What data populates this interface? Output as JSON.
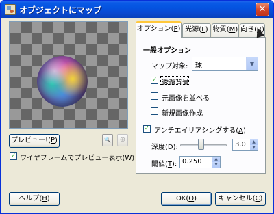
{
  "window": {
    "title": "オブジェクトにマップ",
    "close_glyph": "✕"
  },
  "preview": {
    "button_label": "プレビュー!",
    "button_mnemonic": "P",
    "wireframe_label": "ワイヤフレームでプレビュー表示",
    "wireframe_mnemonic": "W",
    "wireframe_checked": true,
    "zoom_out_glyph": "🔍",
    "zoom_in_glyph": "⊕"
  },
  "tabs": [
    {
      "label": "オプション",
      "mnemonic": "P",
      "active": true
    },
    {
      "label": "光源",
      "mnemonic": "L",
      "active": false
    },
    {
      "label": "物質",
      "mnemonic": "M",
      "active": false
    },
    {
      "label": "向き",
      "mnemonic": "R",
      "active": false
    }
  ],
  "options": {
    "section_title": "一般オプション",
    "map_target_label": "マップ対象:",
    "map_target_value": "球",
    "transparent_bg_label": "透過背景",
    "transparent_bg_checked": true,
    "tile_source_label": "元画像を並べる",
    "tile_source_checked": false,
    "new_image_label": "新規画像作成",
    "new_image_checked": false,
    "antialias_label": "アンチエイリアシングする",
    "antialias_mnemonic": "A",
    "antialias_checked": true,
    "depth_label": "深度",
    "depth_mnemonic": "D",
    "depth_value": "3.0",
    "depth_slider_fraction": 0.44,
    "threshold_label": "閾値",
    "threshold_mnemonic": "T",
    "threshold_value": "0.250"
  },
  "buttons": {
    "help_label": "ヘルプ",
    "help_mnemonic": "H",
    "ok_label": "OK",
    "ok_mnemonic": "O",
    "cancel_label": "キャンセル",
    "cancel_mnemonic": "C"
  }
}
